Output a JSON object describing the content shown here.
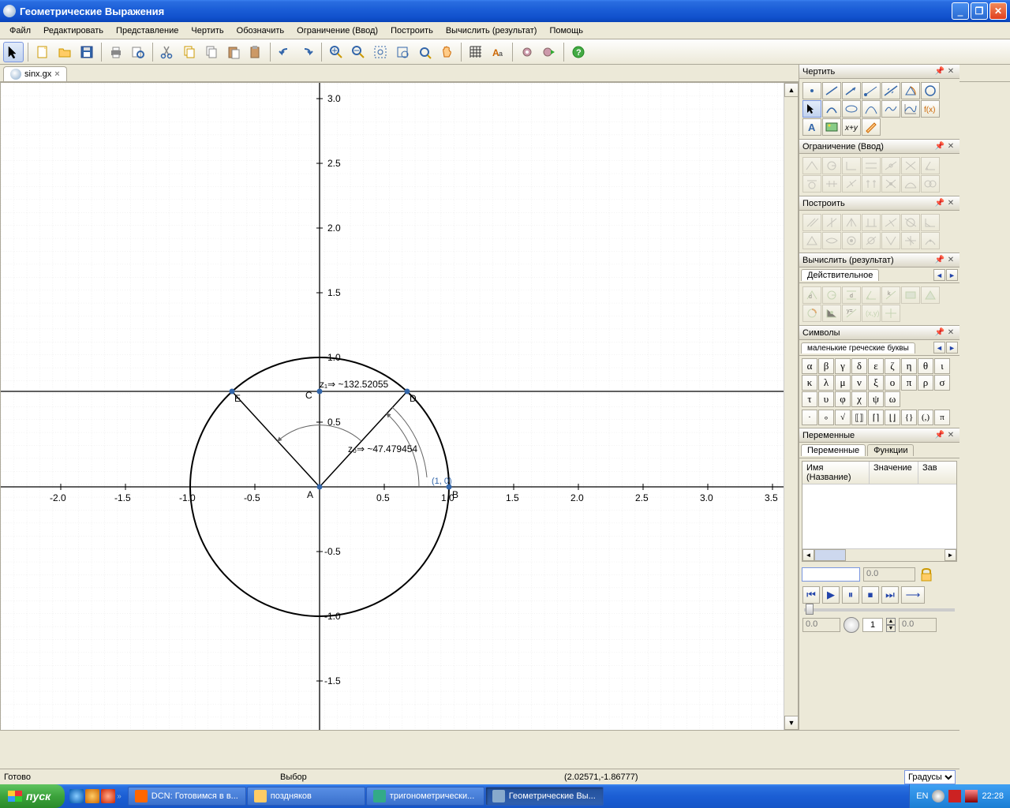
{
  "window": {
    "title": "Геометрические Выражения"
  },
  "menubar": [
    "Файл",
    "Редактировать",
    "Представление",
    "Чертить",
    "Обозначить",
    "Ограничение (Ввод)",
    "Построить",
    "Вычислить (результат)",
    "Помощь"
  ],
  "doc_tab": {
    "name": "sinx.gx"
  },
  "statusbar": {
    "ready": "Готово",
    "mode": "Выбор",
    "coords": "(2.02571,-1.86777)",
    "units": "Градусы"
  },
  "panels": {
    "draw": "Чертить",
    "constrain": "Ограничение (Ввод)",
    "construct": "Построить",
    "calculate": "Вычислить (результат)",
    "calc_tab": "Действительное",
    "symbols": "Символы",
    "symbols_tab": "маленькие греческие буквы",
    "variables": "Переменные",
    "var_tab1": "Переменные",
    "var_tab2": "Функции",
    "var_col1": "Имя (Название)",
    "var_col2": "Значение",
    "var_col3": "Зав",
    "val0": "0.0",
    "spin1": "1"
  },
  "greek_lower": [
    "α",
    "β",
    "γ",
    "δ",
    "ε",
    "ζ",
    "η",
    "θ",
    "ι",
    "κ",
    "λ",
    "μ",
    "ν",
    "ξ",
    "ο",
    "π",
    "ρ",
    "σ",
    "τ",
    "υ",
    "φ",
    "χ",
    "ψ",
    "ω"
  ],
  "sym_extra": [
    "·",
    "∘",
    "√",
    "⟦⟧",
    "⌈⌉",
    "⌊⌋",
    "{}",
    "(,)",
    "π"
  ],
  "chart_data": {
    "type": "geometry",
    "points": {
      "A": {
        "x": 0,
        "y": 0
      },
      "B": {
        "x": 1,
        "y": 0
      },
      "C": {
        "x": 0,
        "y": 0.737
      },
      "D": {
        "x": 0.676,
        "y": 0.737
      },
      "E": {
        "x": -0.676,
        "y": 0.737
      }
    },
    "circle": {
      "center": "A",
      "radius": 1
    },
    "segments": [
      [
        "A",
        "D"
      ],
      [
        "A",
        "E"
      ],
      [
        "E",
        "D"
      ]
    ],
    "horizontal_line_y": 0.737,
    "annotations": {
      "z0": {
        "label": "z₀⇒ ~47.479454",
        "value": 47.479454
      },
      "z1": {
        "label": "z₁⇒ ~132.52055",
        "value": 132.52055
      },
      "B": "(1, 0)"
    },
    "axis": {
      "x_ticks": [
        -2.0,
        -1.5,
        -1.0,
        -0.5,
        0.5,
        1.0,
        1.5,
        2.0,
        2.5,
        3.0,
        3.5
      ],
      "y_ticks": [
        -1.5,
        -1.0,
        -0.5,
        0.5,
        1.0,
        1.5,
        2.0,
        2.5,
        3.0
      ]
    }
  },
  "taskbar": {
    "start": "пуск",
    "tasks": [
      {
        "label": "DCN: Готовимся в в...",
        "color": "#f60"
      },
      {
        "label": "поздняков",
        "color": "#fc6"
      },
      {
        "label": "тригонометрически...",
        "color": "#3a8"
      },
      {
        "label": "Геометрические Вы...",
        "color": "#8ac",
        "active": true
      }
    ],
    "lang": "EN",
    "time": "22:28"
  }
}
